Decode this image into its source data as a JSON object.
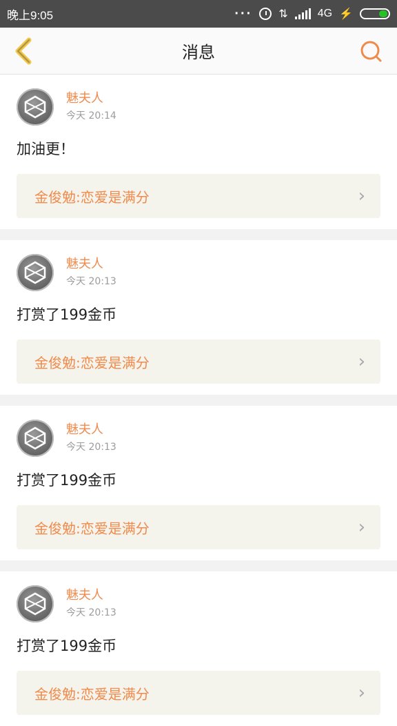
{
  "status_bar": {
    "time": "晚上9:05",
    "network": "4G",
    "battery_color": "#25c225"
  },
  "nav": {
    "title": "消息",
    "back_icon": "chevron-left-icon",
    "search_icon": "search-icon",
    "accent_color": "#f08a4a"
  },
  "messages": [
    {
      "user": "魅夫人",
      "time": "今天 20:14",
      "text": "加油更！",
      "book": "金俊勉:恋爱是满分"
    },
    {
      "user": "魅夫人",
      "time": "今天 20:13",
      "text": "打赏了199金币",
      "book": "金俊勉:恋爱是满分"
    },
    {
      "user": "魅夫人",
      "time": "今天 20:13",
      "text": "打赏了199金币",
      "book": "金俊勉:恋爱是满分"
    },
    {
      "user": "魅夫人",
      "time": "今天 20:13",
      "text": "打赏了199金币",
      "book": "金俊勉:恋爱是满分"
    }
  ]
}
